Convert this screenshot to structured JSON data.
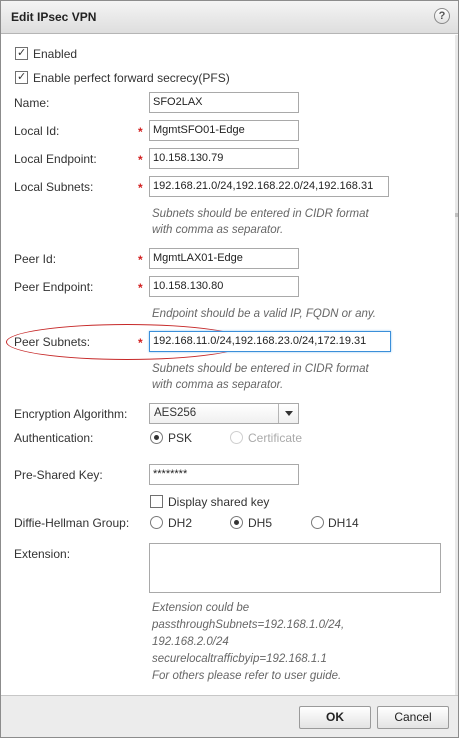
{
  "dialog": {
    "title": "Edit IPsec VPN",
    "help_glyph": "?"
  },
  "options": {
    "enabled_label": "Enabled",
    "enabled_checked": true,
    "pfs_label": "Enable perfect forward secrecy(PFS)",
    "pfs_checked": true
  },
  "fields": {
    "name": {
      "label": "Name:",
      "value": "SFO2LAX"
    },
    "local_id": {
      "label": "Local Id:",
      "value": "MgmtSFO01-Edge"
    },
    "local_endpoint": {
      "label": "Local Endpoint:",
      "value": "10.158.130.79"
    },
    "local_subnets": {
      "label": "Local Subnets:",
      "value": "192.168.21.0/24,192.168.22.0/24,192.168.31",
      "hint_line1": "Subnets should be entered in CIDR format",
      "hint_line2": "with comma as separator."
    },
    "peer_id": {
      "label": "Peer Id:",
      "value": "MgmtLAX01-Edge"
    },
    "peer_endpoint": {
      "label": "Peer Endpoint:",
      "value": "10.158.130.80",
      "hint": "Endpoint should be a valid IP, FQDN or any."
    },
    "peer_subnets": {
      "label": "Peer Subnets:",
      "value": "192.168.11.0/24,192.168.23.0/24,172.19.31",
      "hint_line1": "Subnets should be entered in CIDR format",
      "hint_line2": "with comma as separator."
    },
    "required_marker": "*"
  },
  "encryption": {
    "label": "Encryption Algorithm:",
    "selected": "AES256"
  },
  "authentication": {
    "label": "Authentication:",
    "psk_label": "PSK",
    "certificate_label": "Certificate",
    "selected": "PSK"
  },
  "pre_shared_key": {
    "label": "Pre-Shared Key:",
    "value": "********",
    "display_label": "Display shared key",
    "display_checked": false
  },
  "dh_group": {
    "label": "Diffie-Hellman Group:",
    "dh2": "DH2",
    "dh5": "DH5",
    "dh14": "DH14",
    "selected": "DH5"
  },
  "extension": {
    "label": "Extension:",
    "value": "",
    "hint_lines": [
      "Extension could be",
      "passthroughSubnets=192.168.1.0/24,",
      "192.168.2.0/24",
      "securelocaltrafficbyip=192.168.1.1",
      "For others please refer to user guide."
    ]
  },
  "footer": {
    "ok_label": "OK",
    "cancel_label": "Cancel"
  },
  "colors": {
    "required": "#d21f1f",
    "annotation_ellipse": "#c62828",
    "focus_border": "#3b8fd9"
  }
}
